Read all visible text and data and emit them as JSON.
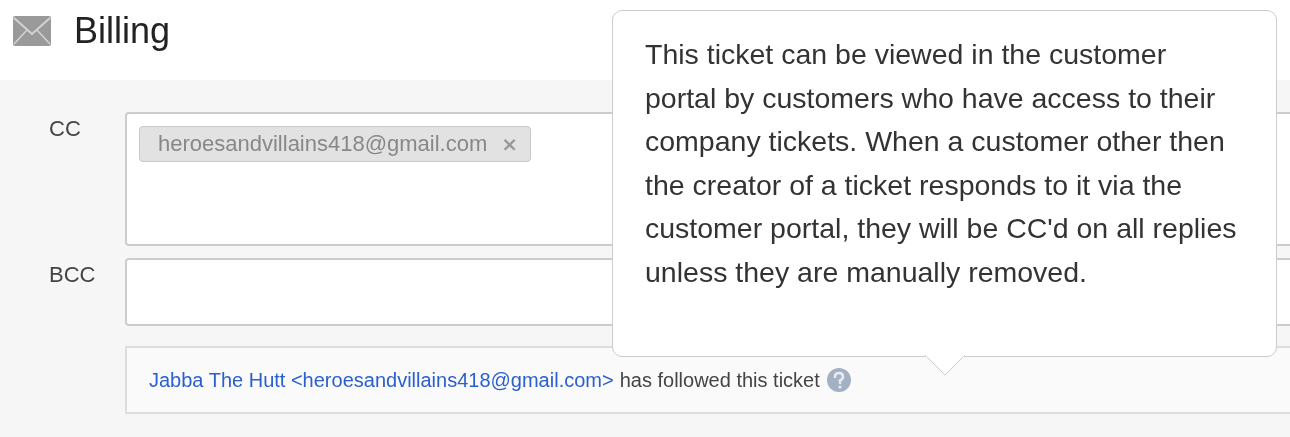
{
  "header": {
    "title": "Billing"
  },
  "cc": {
    "label": "CC",
    "tokens": [
      {
        "email": "heroesandvillains418@gmail.com",
        "remove": "×"
      }
    ]
  },
  "bcc": {
    "label": "BCC"
  },
  "follow_notice": {
    "link": "Jabba The Hutt <heroesandvillains418@gmail.com>",
    "text": "has followed this ticket"
  },
  "tooltip": {
    "text": "This ticket can be viewed in the customer portal by customers who have access to their company tickets. When a customer other then the creator of a ticket responds to it via the customer portal, they will be CC'd on all replies unless they are manually removed."
  }
}
